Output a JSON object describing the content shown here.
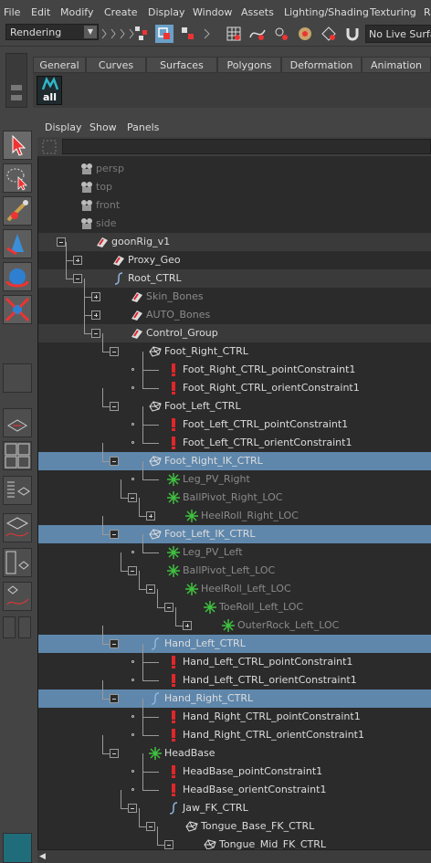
{
  "menubar": {
    "items": [
      "File",
      "Edit",
      "Modify",
      "Create",
      "Display",
      "Window",
      "Assets",
      "Lighting/Shading",
      "Texturing",
      "R"
    ]
  },
  "statusline": {
    "mode": "Rendering",
    "live_surface": "No Live Surface"
  },
  "shelf": {
    "tabs": [
      "General",
      "Curves",
      "Surfaces",
      "Polygons",
      "Deformation",
      "Animation"
    ],
    "button_label": "all"
  },
  "outliner": {
    "menu": [
      "Display",
      "Show",
      "Panels"
    ],
    "rows": [
      {
        "label": "persp",
        "type": "camera",
        "dim": true
      },
      {
        "label": "top",
        "type": "camera",
        "dim": true
      },
      {
        "label": "front",
        "type": "camera",
        "dim": true
      },
      {
        "label": "side",
        "type": "camera",
        "dim": true
      },
      {
        "label": "goonRig_v1",
        "type": "group",
        "state": "expanded"
      },
      {
        "label": "Proxy_Geo",
        "type": "group",
        "state": "collapsed"
      },
      {
        "label": "Root_CTRL",
        "type": "curve",
        "state": "expanded"
      },
      {
        "label": "Skin_Bones",
        "type": "group",
        "state": "collapsed",
        "dim": true
      },
      {
        "label": "AUTO_Bones",
        "type": "group",
        "state": "collapsed",
        "dim": true
      },
      {
        "label": "Control_Group",
        "type": "group",
        "state": "expanded"
      },
      {
        "label": "Foot_Right_CTRL",
        "type": "mesh-ctrl",
        "state": "expanded"
      },
      {
        "label": "Foot_Right_CTRL_pointConstraint1",
        "type": "constraint"
      },
      {
        "label": "Foot_Right_CTRL_orientConstraint1",
        "type": "constraint"
      },
      {
        "label": "Foot_Left_CTRL",
        "type": "mesh-ctrl",
        "state": "expanded"
      },
      {
        "label": "Foot_Left_CTRL_pointConstraint1",
        "type": "constraint"
      },
      {
        "label": "Foot_Left_CTRL_orientConstraint1",
        "type": "constraint"
      },
      {
        "label": "Foot_Right_IK_CTRL",
        "type": "mesh-ctrl",
        "state": "expanded",
        "selected": true
      },
      {
        "label": "Leg_PV_Right",
        "type": "locator",
        "dim": true
      },
      {
        "label": "BallPivot_Right_LOC",
        "type": "locator",
        "state": "expanded",
        "dim": true
      },
      {
        "label": "HeelRoll_Right_LOC",
        "type": "locator",
        "state": "collapsed",
        "dim": true
      },
      {
        "label": "Foot_Left_IK_CTRL",
        "type": "mesh-ctrl",
        "state": "expanded",
        "selected": true
      },
      {
        "label": "Leg_PV_Left",
        "type": "locator",
        "dim": true
      },
      {
        "label": "BallPivot_Left_LOC",
        "type": "locator",
        "state": "expanded",
        "dim": true
      },
      {
        "label": "HeelRoll_Left_LOC",
        "type": "locator",
        "state": "expanded",
        "dim": true
      },
      {
        "label": "ToeRoll_Left_LOC",
        "type": "locator",
        "state": "expanded",
        "dim": true
      },
      {
        "label": "OuterRock_Left_LOC",
        "type": "locator",
        "state": "collapsed",
        "dim": true
      },
      {
        "label": "Hand_Left_CTRL",
        "type": "curve",
        "state": "expanded",
        "selected": true
      },
      {
        "label": "Hand_Left_CTRL_pointConstraint1",
        "type": "constraint"
      },
      {
        "label": "Hand_Left_CTRL_orientConstraint1",
        "type": "constraint"
      },
      {
        "label": "Hand_Right_CTRL",
        "type": "curve",
        "state": "expanded",
        "selected": true
      },
      {
        "label": "Hand_Right_CTRL_pointConstraint1",
        "type": "constraint"
      },
      {
        "label": "Hand_Right_CTRL_orientConstraint1",
        "type": "constraint"
      },
      {
        "label": "HeadBase",
        "type": "locator",
        "state": "expanded"
      },
      {
        "label": "HeadBase_pointConstraint1",
        "type": "constraint"
      },
      {
        "label": "HeadBase_orientConstraint1",
        "type": "constraint"
      },
      {
        "label": "Jaw_FK_CTRL",
        "type": "curve",
        "state": "expanded"
      },
      {
        "label": "Tongue_Base_FK_CTRL",
        "type": "mesh-ctrl",
        "state": "expanded"
      },
      {
        "label": "Tongue_Mid_FK_CTRL",
        "type": "mesh-ctrl",
        "state": "expanded"
      }
    ]
  },
  "colors": {
    "selected_row": "#5f87ac",
    "panel_bg": "#2b2b2b",
    "ui_bg": "#444444",
    "constraint_red": "#e0262a",
    "locator_green": "#3fc13f",
    "curve_blue": "#8fb6e0"
  },
  "icons": [
    "select-tool-icon",
    "lasso-tool-icon",
    "paint-select-icon",
    "move-tool-icon",
    "rotate-tool-icon",
    "scale-tool-icon",
    "camera-icon",
    "group-icon",
    "curve-icon",
    "constraint-icon",
    "locator-icon",
    "mesh-ctrl-icon"
  ]
}
